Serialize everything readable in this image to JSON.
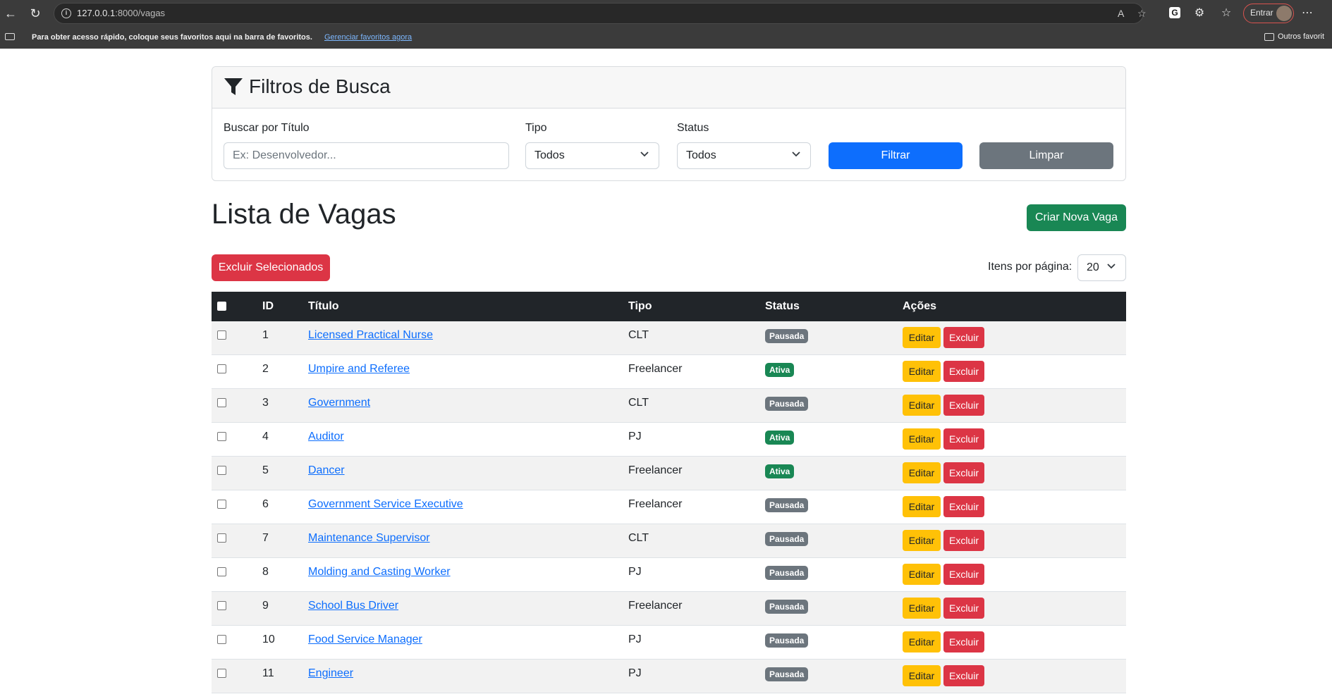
{
  "browser": {
    "url_host": "127.0.0.1",
    "url_rest": ":8000/vagas",
    "signin_label": "Entrar",
    "favorites_message": "Para obter acesso rápido, coloque seus favoritos aqui na barra de favoritos.",
    "favorites_link": "Gerenciar favoritos agora",
    "other_favorites": "Outros favorit"
  },
  "filters": {
    "title": "Filtros de Busca",
    "search_label": "Buscar por Título",
    "search_placeholder": "Ex: Desenvolvedor...",
    "search_value": "",
    "tipo_label": "Tipo",
    "tipo_value": "Todos",
    "status_label": "Status",
    "status_value": "Todos",
    "filter_button": "Filtrar",
    "clear_button": "Limpar"
  },
  "page": {
    "title": "Lista de Vagas",
    "create_button": "Criar Nova Vaga",
    "delete_selected_button": "Excluir Selecionados",
    "per_page_label": "Itens por página:",
    "per_page_value": "20"
  },
  "table": {
    "headers": {
      "id": "ID",
      "title": "Título",
      "type": "Tipo",
      "status": "Status",
      "actions": "Ações"
    },
    "edit_label": "Editar",
    "delete_label": "Excluir",
    "rows": [
      {
        "id": "1",
        "title": "Licensed Practical Nurse",
        "type": "CLT",
        "status": "Pausada"
      },
      {
        "id": "2",
        "title": "Umpire and Referee",
        "type": "Freelancer",
        "status": "Ativa"
      },
      {
        "id": "3",
        "title": "Government",
        "type": "CLT",
        "status": "Pausada"
      },
      {
        "id": "4",
        "title": "Auditor",
        "type": "PJ",
        "status": "Ativa"
      },
      {
        "id": "5",
        "title": "Dancer",
        "type": "Freelancer",
        "status": "Ativa"
      },
      {
        "id": "6",
        "title": "Government Service Executive",
        "type": "Freelancer",
        "status": "Pausada"
      },
      {
        "id": "7",
        "title": "Maintenance Supervisor",
        "type": "CLT",
        "status": "Pausada"
      },
      {
        "id": "8",
        "title": "Molding and Casting Worker",
        "type": "PJ",
        "status": "Pausada"
      },
      {
        "id": "9",
        "title": "School Bus Driver",
        "type": "Freelancer",
        "status": "Pausada"
      },
      {
        "id": "10",
        "title": "Food Service Manager",
        "type": "PJ",
        "status": "Pausada"
      },
      {
        "id": "11",
        "title": "Engineer",
        "type": "PJ",
        "status": "Pausada"
      }
    ]
  },
  "colors": {
    "primary": "#0d6efd",
    "secondary": "#6c757d",
    "success": "#198754",
    "danger": "#dc3545",
    "warning": "#ffc107",
    "dark": "#212529"
  }
}
